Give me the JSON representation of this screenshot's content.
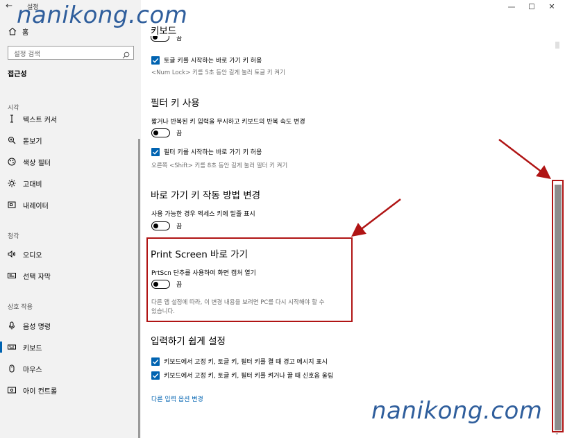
{
  "window": {
    "title": "설정",
    "controls": {
      "minimize": "—",
      "maximize": "□",
      "close": "✕"
    }
  },
  "sidebar": {
    "home_label": "홈",
    "search_placeholder": "설정 검색",
    "section_title": "접근성",
    "groups": {
      "vision": "시각",
      "hearing": "청각",
      "interaction": "상호 작용"
    },
    "items": [
      {
        "label": "텍스트 커서",
        "icon": "text-cursor-icon"
      },
      {
        "label": "돋보기",
        "icon": "magnifier-icon"
      },
      {
        "label": "색상 필터",
        "icon": "color-filter-icon"
      },
      {
        "label": "고대비",
        "icon": "high-contrast-icon"
      },
      {
        "label": "내레이터",
        "icon": "narrator-icon"
      },
      {
        "label": "오디오",
        "icon": "audio-icon"
      },
      {
        "label": "선택 자막",
        "icon": "captions-icon"
      },
      {
        "label": "음성 명령",
        "icon": "microphone-icon"
      },
      {
        "label": "키보드",
        "icon": "keyboard-icon",
        "active": true
      },
      {
        "label": "마우스",
        "icon": "mouse-icon"
      },
      {
        "label": "아이 컨트롤",
        "icon": "eye-control-icon"
      }
    ]
  },
  "main": {
    "keyboard_heading": "키보드",
    "toggle_keys": {
      "check_label": "토글 키를 시작하는 바로 가기 키 허용",
      "check_hint": "<Num Lock> 키를 5초 동안 길게 눌러 토글 키 켜기"
    },
    "filter_keys": {
      "heading": "필터 키 사용",
      "desc": "짧거나 반복된 키 입력을 무시하고 키보드의 반복 속도 변경",
      "toggle_state": "끔",
      "check_label": "필터 키를 시작하는 바로 가기 키 허용",
      "check_hint": "오른쪽 <Shift> 키를 8초 동안 길게 눌러 필터 키 켜기"
    },
    "shortcut_keys": {
      "heading": "바로 가기 키 작동 방법 변경",
      "desc": "사용 가능한 경우 액세스 키에 밑줄 표시",
      "toggle_state": "끔"
    },
    "print_screen": {
      "heading": "Print Screen 바로 가기",
      "desc": "PrtScn 단추를 사용하여 화면 캡처 열기",
      "toggle_state": "끔",
      "note_line1": "다른 앱 설정에 따라, 이 변경 내용을 보려면 PC를 다시 시작해야 할 수",
      "note_line2": "있습니다."
    },
    "typing": {
      "heading": "입력하기 쉽게 설정",
      "check1": "키보드에서 고정 키, 토글 키, 필터 키를 켤 때 경고 메시지 표시",
      "check2": "키보드에서 고정 키, 토글 키, 필터 키를 켜거나 끌 때 신호음 울림",
      "link": "다른 입력 옵션 변경"
    },
    "partial_toggle_state": "끔"
  },
  "watermark": {
    "top": "nanikong.com",
    "bottom": "nanikong.com"
  },
  "colors": {
    "accent": "#0063b1",
    "annotation": "#b01414",
    "watermark": "#2f5e9c",
    "sidebar_bg": "#f2f2f2"
  }
}
